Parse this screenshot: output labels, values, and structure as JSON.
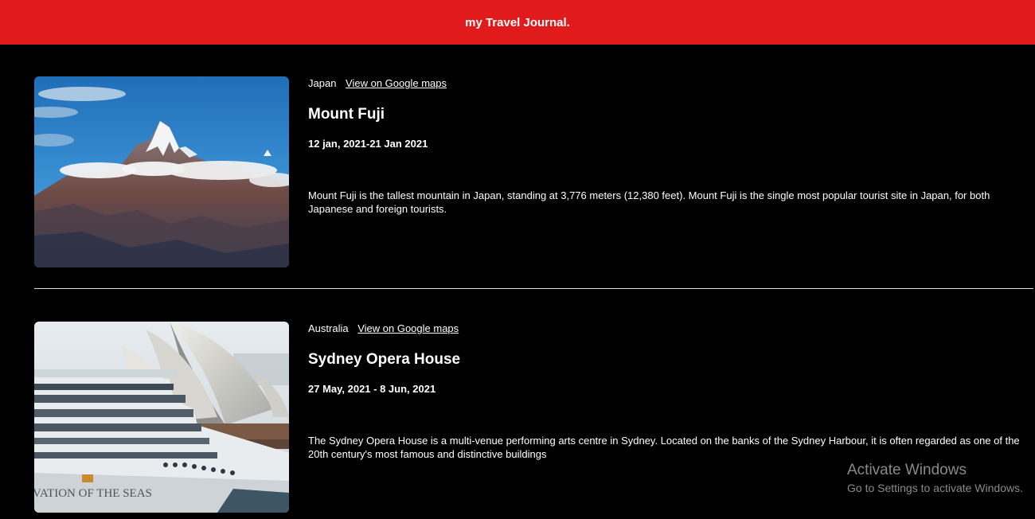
{
  "header": {
    "title": "my Travel Journal."
  },
  "entries": [
    {
      "country": "Japan",
      "maps_link": "View on Google maps",
      "title": "Mount Fuji",
      "dates": "12 jan, 2021-21 Jan 2021",
      "description": "Mount Fuji is the tallest mountain in Japan, standing at 3,776 meters (12,380 feet). Mount Fuji is the single most popular tourist site in Japan, for both Japanese and foreign tourists."
    },
    {
      "country": "Australia",
      "maps_link": "View on Google maps",
      "title": "Sydney Opera House",
      "dates": "27 May, 2021 - 8 Jun, 2021",
      "description": "The Sydney Opera House is a multi-venue performing arts centre in Sydney. Located on the banks of the Sydney Harbour, it is often regarded as one of the 20th century's most famous and distinctive buildings",
      "ship_lettering": "VATION OF THE SEAS"
    }
  ],
  "watermark": {
    "title": "Activate Windows",
    "subtitle": "Go to Settings to activate Windows."
  },
  "colors": {
    "header_bg": "#e11b1b",
    "page_bg": "#000000",
    "text": "#ffffff",
    "divider": "#d9d9d9",
    "watermark": "#8a8a8a"
  }
}
